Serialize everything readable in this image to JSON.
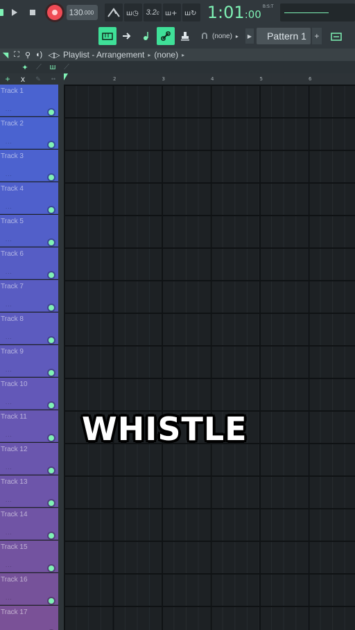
{
  "toolbar": {
    "tempo": "130",
    "tempo_decimal": ".000",
    "time_main": "1:01",
    "time_ms": ":00",
    "time_unit": "B:S:T",
    "pattern_prefix": "(none)",
    "pattern_name": "Pattern 1",
    "plus": "+",
    "counter_label": "3.2"
  },
  "playlist": {
    "title": "Playlist - Arrangement",
    "current": "(none)"
  },
  "track_head": {
    "add": "+",
    "remove": "x"
  },
  "ruler": {
    "bars": [
      "2",
      "3",
      "4",
      "5",
      "6"
    ]
  },
  "tracks": [
    {
      "name": "Track 1",
      "color": "#4a63d0"
    },
    {
      "name": "Track 2",
      "color": "#4a63d0"
    },
    {
      "name": "Track 3",
      "color": "#4c62cf"
    },
    {
      "name": "Track 4",
      "color": "#4f60cc"
    },
    {
      "name": "Track 5",
      "color": "#525fc9"
    },
    {
      "name": "Track 6",
      "color": "#565dc5"
    },
    {
      "name": "Track 7",
      "color": "#595cc2"
    },
    {
      "name": "Track 8",
      "color": "#5c5bbf"
    },
    {
      "name": "Track 9",
      "color": "#5f5abc"
    },
    {
      "name": "Track 10",
      "color": "#6358b8"
    },
    {
      "name": "Track 11",
      "color": "#6757b3"
    },
    {
      "name": "Track 12",
      "color": "#6a56ae"
    },
    {
      "name": "Track 13",
      "color": "#6d55aa"
    },
    {
      "name": "Track 14",
      "color": "#7054a5"
    },
    {
      "name": "Track 15",
      "color": "#7353a0"
    },
    {
      "name": "Track 16",
      "color": "#76529a"
    },
    {
      "name": "Track 17",
      "color": "#7a5197"
    }
  ],
  "overlay": {
    "text": "WHISTLE"
  },
  "colors": {
    "accent": "#7ff2b5",
    "record": "#ef4b55",
    "background": "#1d2124"
  }
}
